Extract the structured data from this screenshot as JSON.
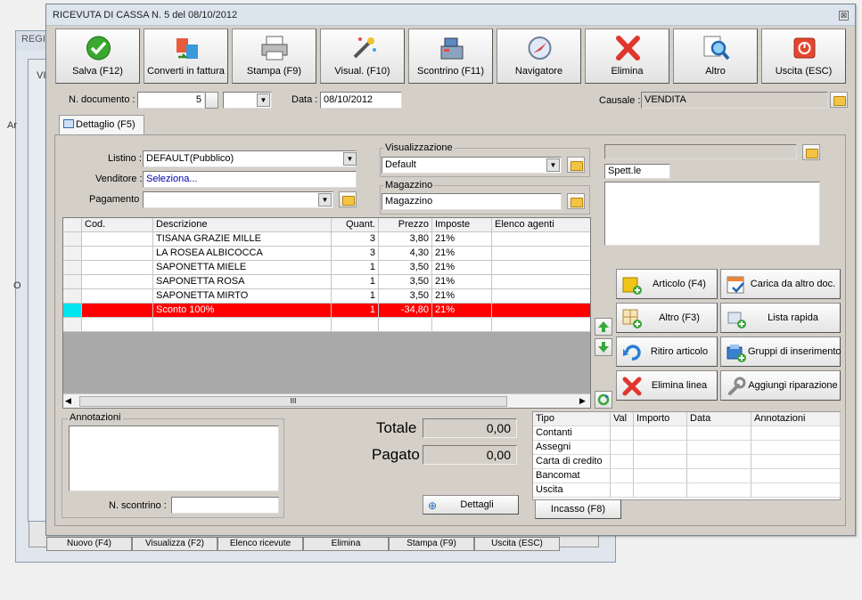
{
  "background": {
    "title_partial": "REGIS",
    "tab_partial": "VI",
    "letter_a": "Ar",
    "letter_o": "O",
    "buttons": [
      "Nuovo (F4)",
      "Visualizza (F2)",
      "Elenco ricevute",
      "Elimina",
      "Stampa (F9)",
      "Uscita (ESC)"
    ]
  },
  "window": {
    "title": "RICEVUTA DI CASSA N. 5  del 08/10/2012",
    "close_icon": "close-icon"
  },
  "toolbar": [
    {
      "label": "Salva (F12)",
      "icon": "check-icon"
    },
    {
      "label": "Converti in fattura",
      "icon": "convert-icon"
    },
    {
      "label": "Stampa (F9)",
      "icon": "printer-icon"
    },
    {
      "label": "Visual. (F10)",
      "icon": "magic-wand-icon"
    },
    {
      "label": "Scontrino (F11)",
      "icon": "cash-register-icon"
    },
    {
      "label": "Navigatore",
      "icon": "compass-icon"
    },
    {
      "label": "Elimina",
      "icon": "delete-icon"
    },
    {
      "label": "Altro",
      "icon": "magnifier-icon"
    },
    {
      "label": "Uscita (ESC)",
      "icon": "power-icon"
    }
  ],
  "header": {
    "doc_label": "N. documento :",
    "doc_value": "5",
    "data_label": "Data :",
    "data_value": "08/10/2012",
    "causale_label": "Causale :",
    "causale_value": "VENDITA"
  },
  "tab": {
    "label": "Dettaglio (F5)"
  },
  "form": {
    "listino_label": "Listino :",
    "listino_value": "DEFAULT(Pubblico)",
    "venditore_label": "Venditore :",
    "venditore_value": "Seleziona...",
    "pagamento_label": "Pagamento :",
    "pagamento_value": "",
    "visualizzazione_title": "Visualizzazione",
    "visualizzazione_value": "Default",
    "magazzino_title": "Magazzino",
    "magazzino_value": "Magazzino",
    "cliente_value": "Spett.le"
  },
  "grid": {
    "columns": [
      "",
      "Cod.",
      "Descrizione",
      "Quant.",
      "Prezzo",
      "Imposte",
      "Elenco agenti"
    ],
    "rows": [
      {
        "cod": "",
        "desc": "TISANA GRAZIE MILLE",
        "qty": "3",
        "price": "3,80",
        "tax": "21%",
        "agents": ""
      },
      {
        "cod": "",
        "desc": "LA ROSEA ALBICOCCA",
        "qty": "3",
        "price": "4,30",
        "tax": "21%",
        "agents": ""
      },
      {
        "cod": "",
        "desc": "SAPONETTA MIELE",
        "qty": "1",
        "price": "3,50",
        "tax": "21%",
        "agents": ""
      },
      {
        "cod": "",
        "desc": "SAPONETTA ROSA",
        "qty": "1",
        "price": "3,50",
        "tax": "21%",
        "agents": ""
      },
      {
        "cod": "",
        "desc": "SAPONETTA MIRTO",
        "qty": "1",
        "price": "3,50",
        "tax": "21%",
        "agents": ""
      },
      {
        "cod": "",
        "desc": "Sconto 100%",
        "qty": "1",
        "price": "-34,80",
        "tax": "21%",
        "agents": ""
      }
    ],
    "scroll_mark": "III"
  },
  "actions": [
    {
      "label": "Articolo (F4)",
      "icon": "article-add-icon"
    },
    {
      "label": "Carica da altro doc.",
      "icon": "load-doc-icon"
    },
    {
      "label": "Altro (F3)",
      "icon": "grid-add-icon"
    },
    {
      "label": "Lista rapida",
      "icon": "quick-list-icon"
    },
    {
      "label": "Ritiro articolo",
      "icon": "undo-icon"
    },
    {
      "label": "Gruppi di inserimento",
      "icon": "group-add-icon"
    },
    {
      "label": "Elimina linea",
      "icon": "delete-icon"
    },
    {
      "label": "Aggiungi riparazione",
      "icon": "wrench-icon"
    }
  ],
  "annotazioni": {
    "title": "Annotazioni",
    "value": ""
  },
  "scontrino": {
    "label": "N. scontrino :",
    "value": ""
  },
  "totals": {
    "totale_label": "Totale",
    "totale_value": "0,00",
    "pagato_label": "Pagato",
    "pagato_value": "0,00",
    "dettagli_label": "Dettagli"
  },
  "payments": {
    "columns": [
      "Tipo",
      "Val",
      "Importo",
      "Data",
      "Annotazioni"
    ],
    "rows": [
      "Contanti",
      "Assegni",
      "Carta di credito",
      "Bancomat",
      "Uscita"
    ],
    "incasso_label": "Incasso (F8)"
  },
  "colors": {
    "selected_row": "#ff0000",
    "row_marker": "#00e5ee"
  }
}
